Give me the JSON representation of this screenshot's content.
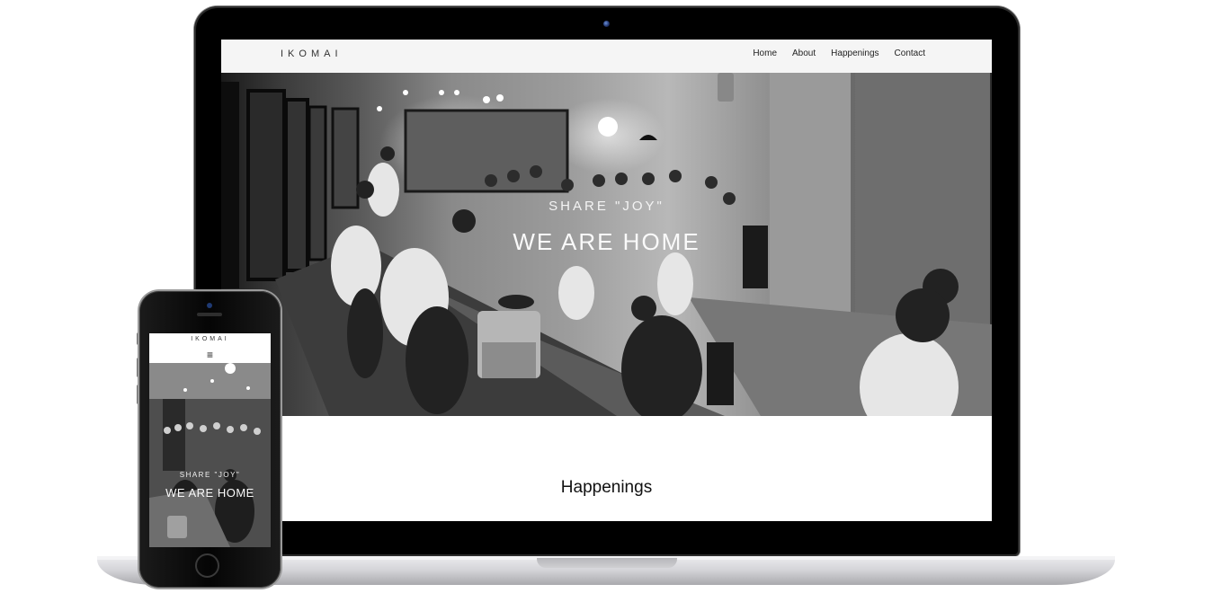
{
  "laptop": {
    "site": {
      "logo": "IKOMAI",
      "nav": [
        {
          "label": "Home"
        },
        {
          "label": "About"
        },
        {
          "label": "Happenings"
        },
        {
          "label": "Contact"
        }
      ],
      "hero": {
        "kicker": "SHARE \"JOY\"",
        "title": "WE ARE HOME"
      },
      "section_heading": "Happenings"
    }
  },
  "phone": {
    "site": {
      "logo": "IKOMAI",
      "menu_icon": "≡",
      "hero": {
        "kicker": "SHARE \"JOY\"",
        "title": "WE ARE HOME"
      }
    }
  }
}
